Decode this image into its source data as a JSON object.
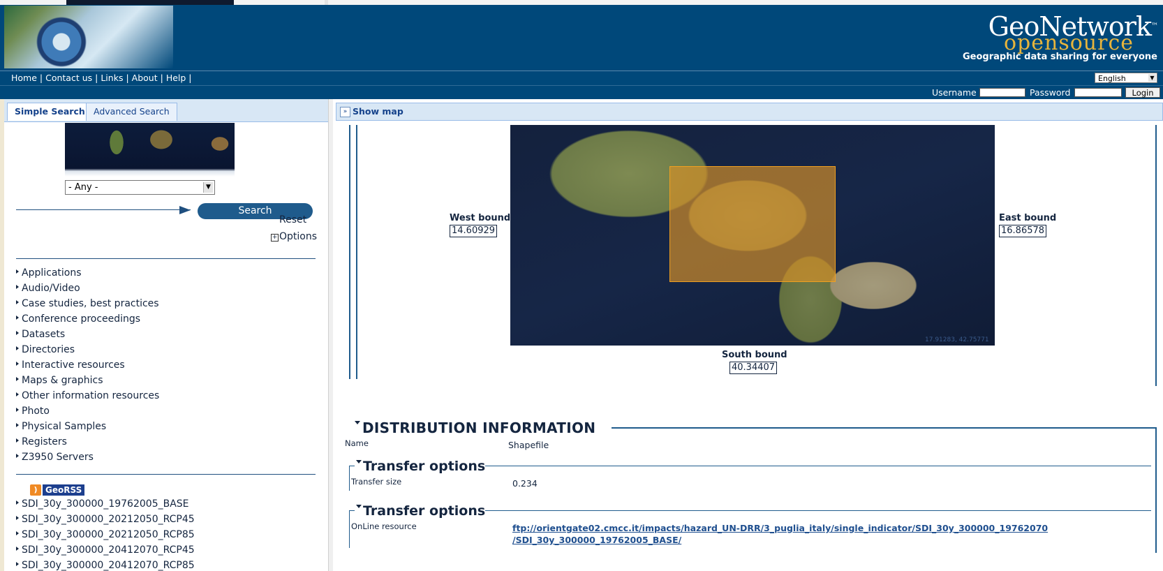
{
  "header": {
    "brand_top": "GeoNetwork",
    "brand_tm": "™",
    "brand_bottom": "opensource",
    "tagline": "Geographic data sharing for everyone"
  },
  "nav": {
    "home": "Home",
    "contact": "Contact us",
    "links": "Links",
    "about": "About",
    "help": "Help",
    "sep": "|",
    "language": "English"
  },
  "login": {
    "username_label": "Username",
    "password_label": "Password",
    "login_button": "Login"
  },
  "left": {
    "tab_simple": "Simple Search",
    "tab_advanced": "Advanced Search",
    "region_select": "- Any -",
    "search_button": "Search",
    "reset_link": "Reset",
    "options_link": "Options",
    "options_toggle": "+",
    "categories": [
      "Applications",
      "Audio/Video",
      "Case studies, best practices",
      "Conference proceedings",
      "Datasets",
      "Directories",
      "Interactive resources",
      "Maps & graphics",
      "Other information resources",
      "Photo",
      "Physical Samples",
      "Registers",
      "Z3950 Servers"
    ],
    "georss_label": "GeoRSS",
    "rss_items": [
      "SDI_30y_300000_19762005_BASE",
      "SDI_30y_300000_20212050_RCP45",
      "SDI_30y_300000_20212050_RCP85",
      "SDI_30y_300000_20412070_RCP45",
      "SDI_30y_300000_20412070_RCP85"
    ]
  },
  "right": {
    "show_map": "Show map",
    "map_coordinates": "17.91283, 42.75771",
    "west_label": "West bound",
    "west_value": "14.60929",
    "east_label": "East bound",
    "east_value": "16.86578",
    "south_label": "South bound",
    "south_value": "40.34407",
    "distribution_title": "DISTRIBUTION INFORMATION",
    "name_label": "Name",
    "name_value": "Shapefile",
    "transfer_title_1": "Transfer options",
    "transfer_size_label": "Transfer size",
    "transfer_size_value": "0.234",
    "transfer_title_2": "Transfer options",
    "online_label": "OnLine resource",
    "online_link_line1": "ftp://orientgate02.cmcc.it/impacts/hazard_UN-DRR/3_puglia_italy/single_indicator/SDI_30y_300000_19762070",
    "online_link_line2": "/SDI_30y_300000_19762005_BASE/"
  },
  "colors": {
    "header_blue": "#00487a",
    "bbox_orange": "#d69128",
    "tab_bg": "#d8e7f5"
  },
  "icons": {
    "globe": "globe-logo",
    "rss": "rss-icon",
    "expand": "double-chevron-down-icon"
  }
}
